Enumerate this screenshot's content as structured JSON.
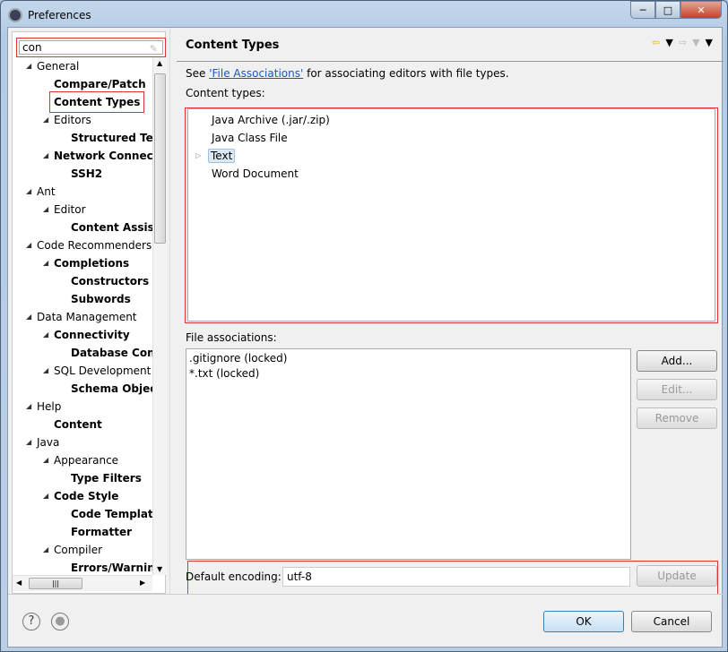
{
  "window": {
    "title": "Preferences",
    "controls": [
      "minimize",
      "maximize",
      "close"
    ]
  },
  "search": {
    "value": "con",
    "clear_icon": "clear-icon"
  },
  "tree": [
    {
      "label": "General",
      "level": 0,
      "expanded": true,
      "bold": false
    },
    {
      "label": "Compare/Patch",
      "level": 1,
      "bold": true
    },
    {
      "label": "Content Types",
      "level": 1,
      "bold": true,
      "selected": true
    },
    {
      "label": "Editors",
      "level": 1,
      "expanded": true,
      "bold": false
    },
    {
      "label": "Structured Tex",
      "level": 2,
      "bold": true
    },
    {
      "label": "Network Connect",
      "level": 1,
      "expanded": true,
      "bold": true
    },
    {
      "label": "SSH2",
      "level": 2,
      "bold": true
    },
    {
      "label": "Ant",
      "level": 0,
      "expanded": true,
      "bold": false
    },
    {
      "label": "Editor",
      "level": 1,
      "expanded": true,
      "bold": false
    },
    {
      "label": "Content Assist",
      "level": 2,
      "bold": true
    },
    {
      "label": "Code Recommenders",
      "level": 0,
      "expanded": true,
      "bold": false
    },
    {
      "label": "Completions",
      "level": 1,
      "expanded": true,
      "bold": true
    },
    {
      "label": "Constructors",
      "level": 2,
      "bold": true
    },
    {
      "label": "Subwords",
      "level": 2,
      "bold": true
    },
    {
      "label": "Data Management",
      "level": 0,
      "expanded": true,
      "bold": false
    },
    {
      "label": "Connectivity",
      "level": 1,
      "expanded": true,
      "bold": true
    },
    {
      "label": "Database Conn",
      "level": 2,
      "bold": true
    },
    {
      "label": "SQL Development",
      "level": 1,
      "expanded": true,
      "bold": false
    },
    {
      "label": "Schema Objec",
      "level": 2,
      "bold": true
    },
    {
      "label": "Help",
      "level": 0,
      "expanded": true,
      "bold": false
    },
    {
      "label": "Content",
      "level": 1,
      "bold": true
    },
    {
      "label": "Java",
      "level": 0,
      "expanded": true,
      "bold": false
    },
    {
      "label": "Appearance",
      "level": 1,
      "expanded": true,
      "bold": false
    },
    {
      "label": "Type Filters",
      "level": 2,
      "bold": true
    },
    {
      "label": "Code Style",
      "level": 1,
      "expanded": true,
      "bold": true
    },
    {
      "label": "Code Templat",
      "level": 2,
      "bold": true
    },
    {
      "label": "Formatter",
      "level": 2,
      "bold": true
    },
    {
      "label": "Compiler",
      "level": 1,
      "expanded": true,
      "bold": false
    },
    {
      "label": "Errors/Warnin",
      "level": 2,
      "bold": true
    }
  ],
  "page": {
    "title": "Content Types",
    "desc_pre": "See ",
    "desc_link": "'File Associations'",
    "desc_post": " for associating editors with file types.",
    "content_types_label": "Content types:",
    "content_types": [
      {
        "label": "Java Archive (.jar/.zip)",
        "expandable": false
      },
      {
        "label": "Java Class File",
        "expandable": false
      },
      {
        "label": "Text",
        "expandable": true,
        "selected": true
      },
      {
        "label": "Word Document",
        "expandable": false
      }
    ],
    "file_assoc_label": "File associations:",
    "file_assoc": [
      ".gitignore (locked)",
      "*.txt (locked)"
    ],
    "buttons": {
      "add": "Add...",
      "edit": "Edit...",
      "remove": "Remove",
      "update": "Update"
    },
    "encoding_label": "Default encoding:",
    "encoding_value": "utf-8"
  },
  "footer": {
    "ok": "OK",
    "cancel": "Cancel"
  },
  "colors": {
    "highlight": "#dd3333",
    "link": "#1a55c0"
  }
}
